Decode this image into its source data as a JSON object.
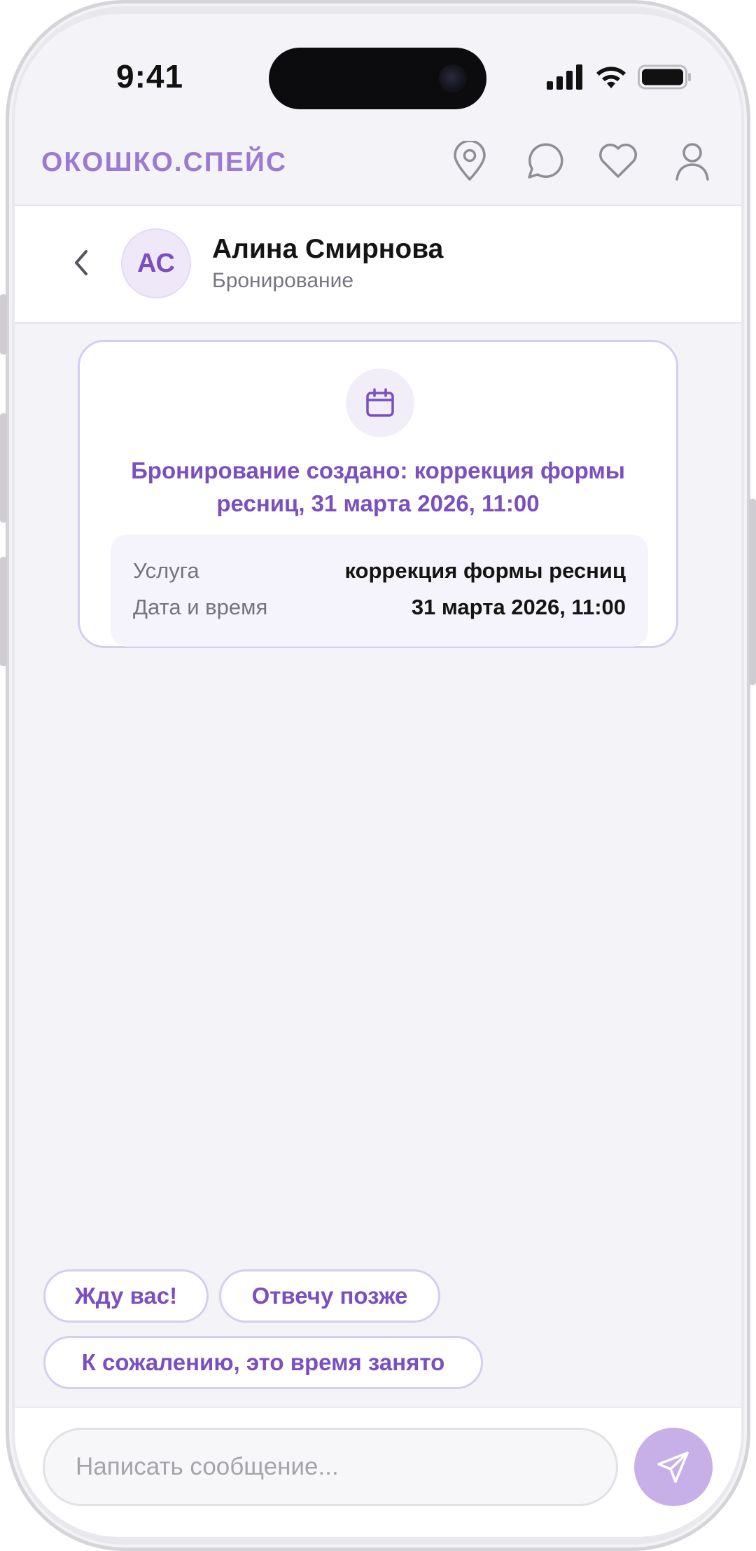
{
  "status_bar": {
    "time": "9:41"
  },
  "header": {
    "logo": "ОКОШКО.СПЕЙС",
    "nav_icons": [
      "location-icon",
      "chat-icon",
      "heart-icon",
      "profile-icon"
    ]
  },
  "chat": {
    "avatar_initials": "АС",
    "contact_name": "Алина Смирнова",
    "contact_subtitle": "Бронирование"
  },
  "booking_card": {
    "icon": "calendar-icon",
    "title": "Бронирование создано: коррекция формы ресниц, 31 марта 2026, 11:00",
    "rows": [
      {
        "label": "Услуга",
        "value": "коррекция формы ресниц"
      },
      {
        "label": "Дата и время",
        "value": "31 марта 2026, 11:00"
      }
    ]
  },
  "quick_replies": [
    "Жду вас!",
    "Отвечу позже",
    "К сожалению, это время занято"
  ],
  "composer": {
    "placeholder": "Написать сообщение...",
    "send_icon": "send-icon"
  },
  "colors": {
    "accent": "#7a4fbf",
    "logo": "#9b7bd2",
    "send_button": "#c7b0e8",
    "background": "#f4f3f8"
  }
}
